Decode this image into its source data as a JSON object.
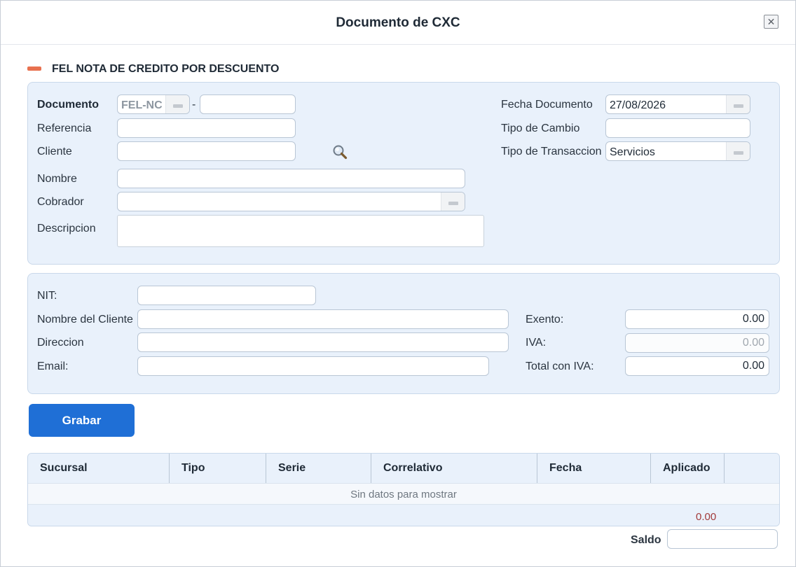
{
  "dialog": {
    "title": "Documento de CXC",
    "close_glyph": "✕"
  },
  "section": {
    "title": "FEL NOTA DE CREDITO POR DESCUENTO"
  },
  "form": {
    "documento_label": "Documento",
    "documento_series": "FEL-NC",
    "documento_separator": "-",
    "documento_number": "",
    "referencia_label": "Referencia",
    "referencia_value": "",
    "cliente_label": "Cliente",
    "cliente_value": "",
    "nombre_label": "Nombre",
    "nombre_value": "",
    "cobrador_label": "Cobrador",
    "cobrador_value": "",
    "descripcion_label": "Descripcion",
    "fecha_label": "Fecha Documento",
    "fecha_value": "27/08/2026",
    "tipo_cambio_label": "Tipo de Cambio",
    "tipo_cambio_value": "",
    "tipo_transaccion_label": "Tipo de Transaccion",
    "tipo_transaccion_value": "Servicios"
  },
  "billing": {
    "nit_label": "NIT:",
    "nit_value": "",
    "nombre_cliente_label": "Nombre del Cliente",
    "nombre_cliente_value": "",
    "direccion_label": "Direccion",
    "direccion_value": "",
    "email_label": "Email:",
    "email_value": "",
    "exento_label": "Exento:",
    "exento_value": "0.00",
    "iva_label": "IVA:",
    "iva_value": "0.00",
    "total_label": "Total con IVA:",
    "total_value": "0.00"
  },
  "actions": {
    "save_label": "Grabar"
  },
  "grid": {
    "columns": [
      "Sucursal",
      "Tipo",
      "Serie",
      "Correlativo",
      "Fecha",
      "Aplicado"
    ],
    "empty_text": "Sin datos para mostrar",
    "total": "0.00"
  },
  "saldo": {
    "label": "Saldo",
    "value": ""
  },
  "colors": {
    "accent": "#1f6fd6",
    "panel": "#e9f1fb",
    "collapse": "#e8714f",
    "total": "#a23a3a"
  },
  "icons": {
    "close": "close-icon",
    "collapse": "collapse-icon",
    "search": "search-icon",
    "dropdown": "dropdown-icon"
  }
}
